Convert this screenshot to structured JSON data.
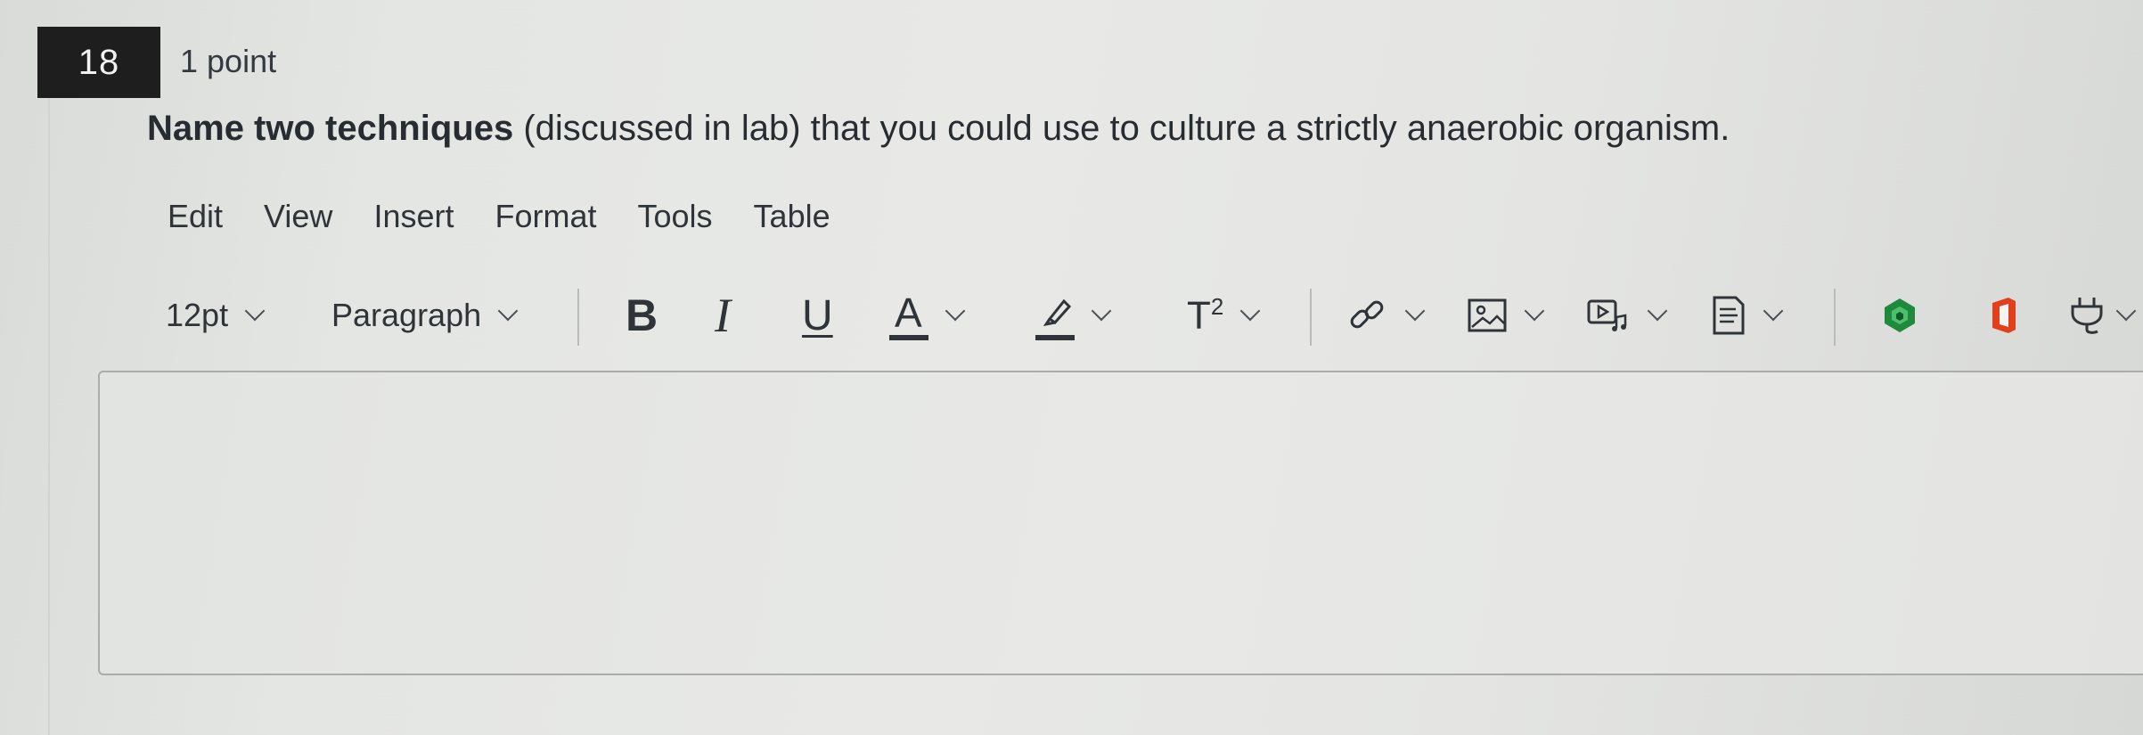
{
  "question": {
    "number": "18",
    "points": "1 point",
    "text_bold": "Name two techniques",
    "text_rest": " (discussed in lab) that you could use to culture a strictly anaerobic organism."
  },
  "menubar": {
    "items": [
      "Edit",
      "View",
      "Insert",
      "Format",
      "Tools",
      "Table"
    ]
  },
  "toolbar": {
    "font_size": "12pt",
    "block_format": "Paragraph",
    "bold_label": "B",
    "italic_label": "I",
    "underline_label": "U",
    "text_color_label": "A",
    "superscript_label": "T",
    "superscript_exponent": "2",
    "icons": {
      "link": "link-icon",
      "image": "image-icon",
      "media": "media-icon",
      "document": "document-icon",
      "apps1": "green-app-icon",
      "apps2": "office-icon",
      "plugin": "plug-icon"
    },
    "colors": {
      "text_color_bar": "#2f3438",
      "highlight_bar": "#2f3438",
      "green_app": "#1f8a3c",
      "office_red": "#e1401a"
    }
  },
  "editor": {
    "content": ""
  }
}
